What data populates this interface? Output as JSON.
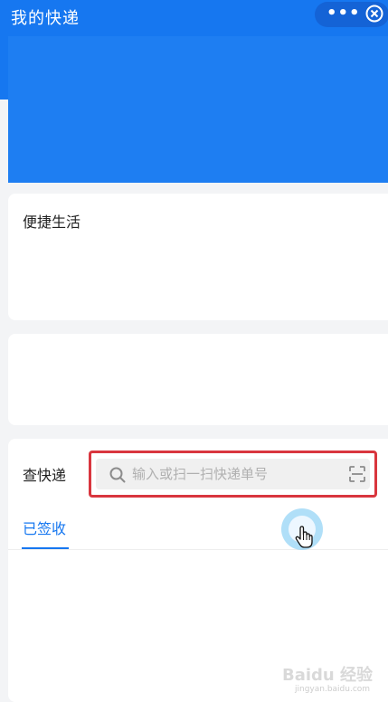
{
  "header": {
    "title": "我的快递",
    "more_icon": "more-dots-icon",
    "close_icon": "close-circle-icon"
  },
  "life_card": {
    "title": "便捷生活"
  },
  "query": {
    "label": "查快递",
    "search_placeholder": "输入或扫一扫快递单号",
    "search_icon": "search-icon",
    "scan_icon": "scan-icon"
  },
  "tabs": [
    {
      "label": "已签收",
      "active": true
    }
  ],
  "watermark": {
    "brand": "Baidu 经验",
    "url": "jingyan.baidu.com"
  },
  "colors": {
    "primary": "#1677f0",
    "highlight_border": "#d9363e"
  }
}
